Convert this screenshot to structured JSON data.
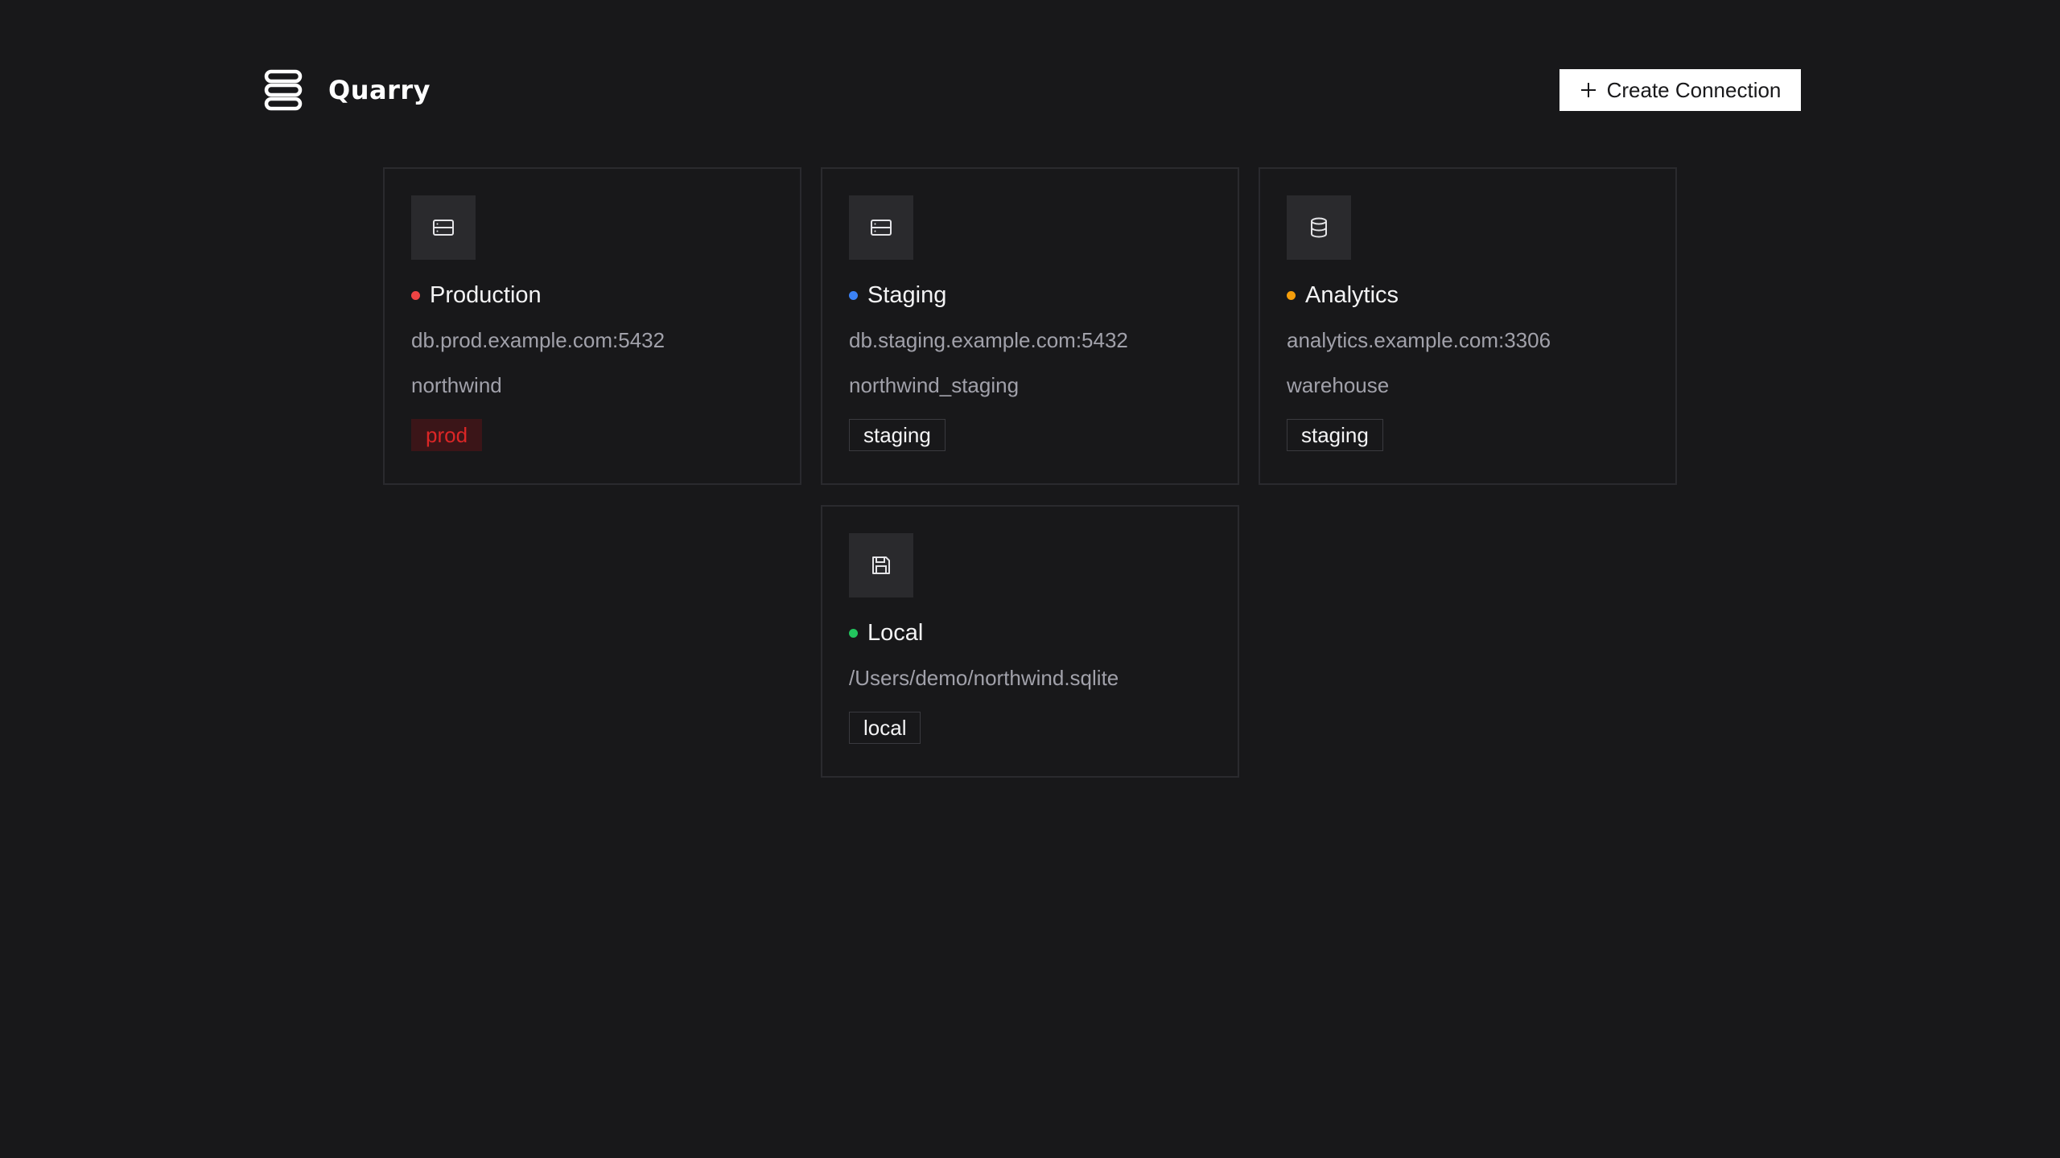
{
  "app": {
    "name": "Quarry"
  },
  "header": {
    "create_button_label": "Create Connection"
  },
  "connections": [
    {
      "name": "Production",
      "status_color": "#ef4444",
      "icon": "server-icon",
      "host": "db.prod.example.com:5432",
      "database": "northwind",
      "tag": "prod"
    },
    {
      "name": "Staging",
      "status_color": "#3b82f6",
      "icon": "server-icon",
      "host": "db.staging.example.com:5432",
      "database": "northwind_staging",
      "tag": "staging"
    },
    {
      "name": "Analytics",
      "status_color": "#f59e0b",
      "icon": "database-icon",
      "host": "analytics.example.com:3306",
      "database": "warehouse",
      "tag": "staging"
    },
    {
      "name": "Local",
      "status_color": "#22c55e",
      "icon": "floppy-disk-icon",
      "path": "/Users/demo/northwind.sqlite",
      "tag": "local"
    }
  ]
}
